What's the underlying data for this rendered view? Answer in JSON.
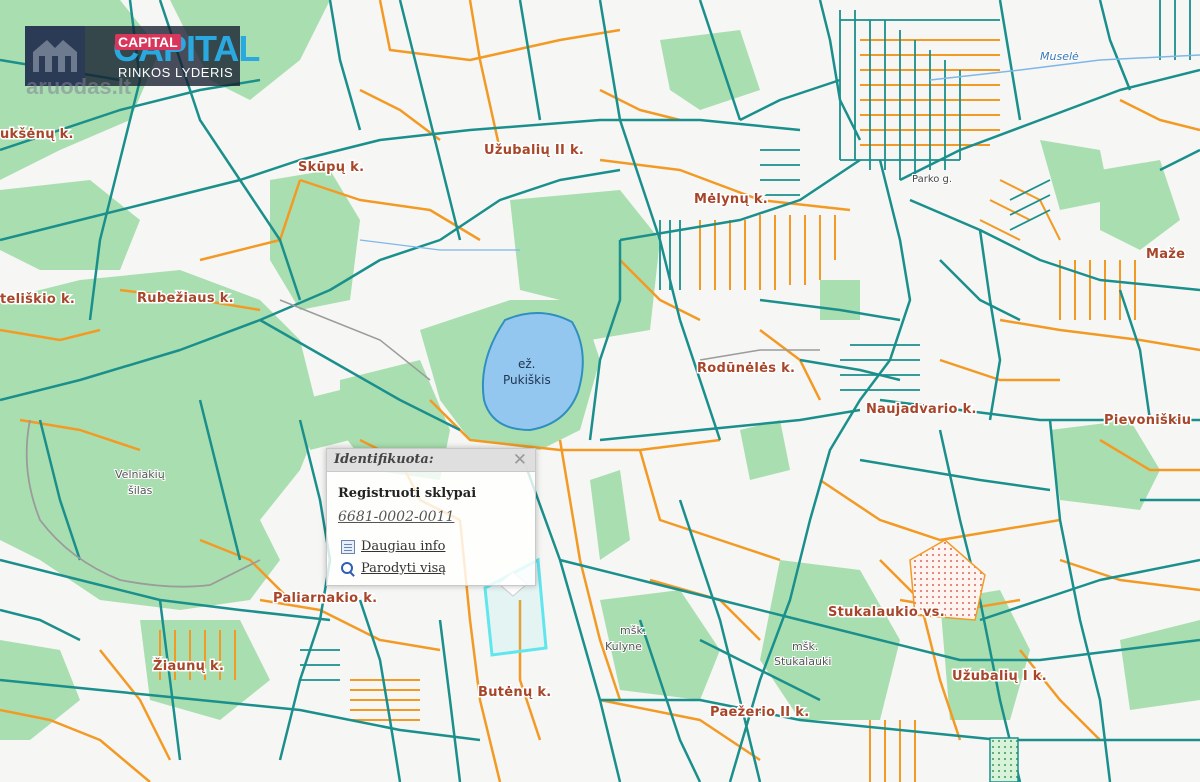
{
  "logo": {
    "brand": "CAPITAL",
    "brand_small": "CAPITAL",
    "tagline": "RINKOS LYDERIS",
    "watermark": "aruodas.lt",
    "building_icon": "building-icon"
  },
  "map": {
    "background": "#f6f6f4",
    "colors": {
      "forest": "#a9dfb0",
      "boundary": "#1a8f8c",
      "parcel": "#f39a24",
      "water": "#94c7f0",
      "label": "#a8462a",
      "highlight": "#61e6ee"
    },
    "lake": {
      "prefix": "ež.",
      "name": "Pukiškis"
    },
    "forest_label": [
      "Velniakių",
      "šilas"
    ],
    "river_label": "Muselė",
    "street_label": "Parko g.",
    "place_labels": [
      "ukšėnų k.",
      "Skūpų k.",
      "Užubalių II k.",
      "Mėlynų k.",
      "Maže",
      "teliškio k.",
      "Rubežiaus k.",
      "Rodūnėlės k.",
      "Naujadvario k.",
      "Pievoniškiu",
      "Paliarnakio k.",
      "Žiaunų k.",
      "Butėnų k.",
      "Stukalaukio vs.",
      "Užubalių I k.",
      "Paežerio II k."
    ],
    "minor_labels": [
      {
        "lines": [
          "mšk.",
          "Kulyne"
        ]
      },
      {
        "lines": [
          "mšk.",
          "Stukalauki"
        ]
      }
    ]
  },
  "popup": {
    "title": "Identifikuota:",
    "close_icon": "close-icon",
    "section": "Registruoti sklypai",
    "parcel_id": "6681-0002-0011",
    "more_info": "Daugiau info",
    "show_all": "Parodyti visą"
  }
}
